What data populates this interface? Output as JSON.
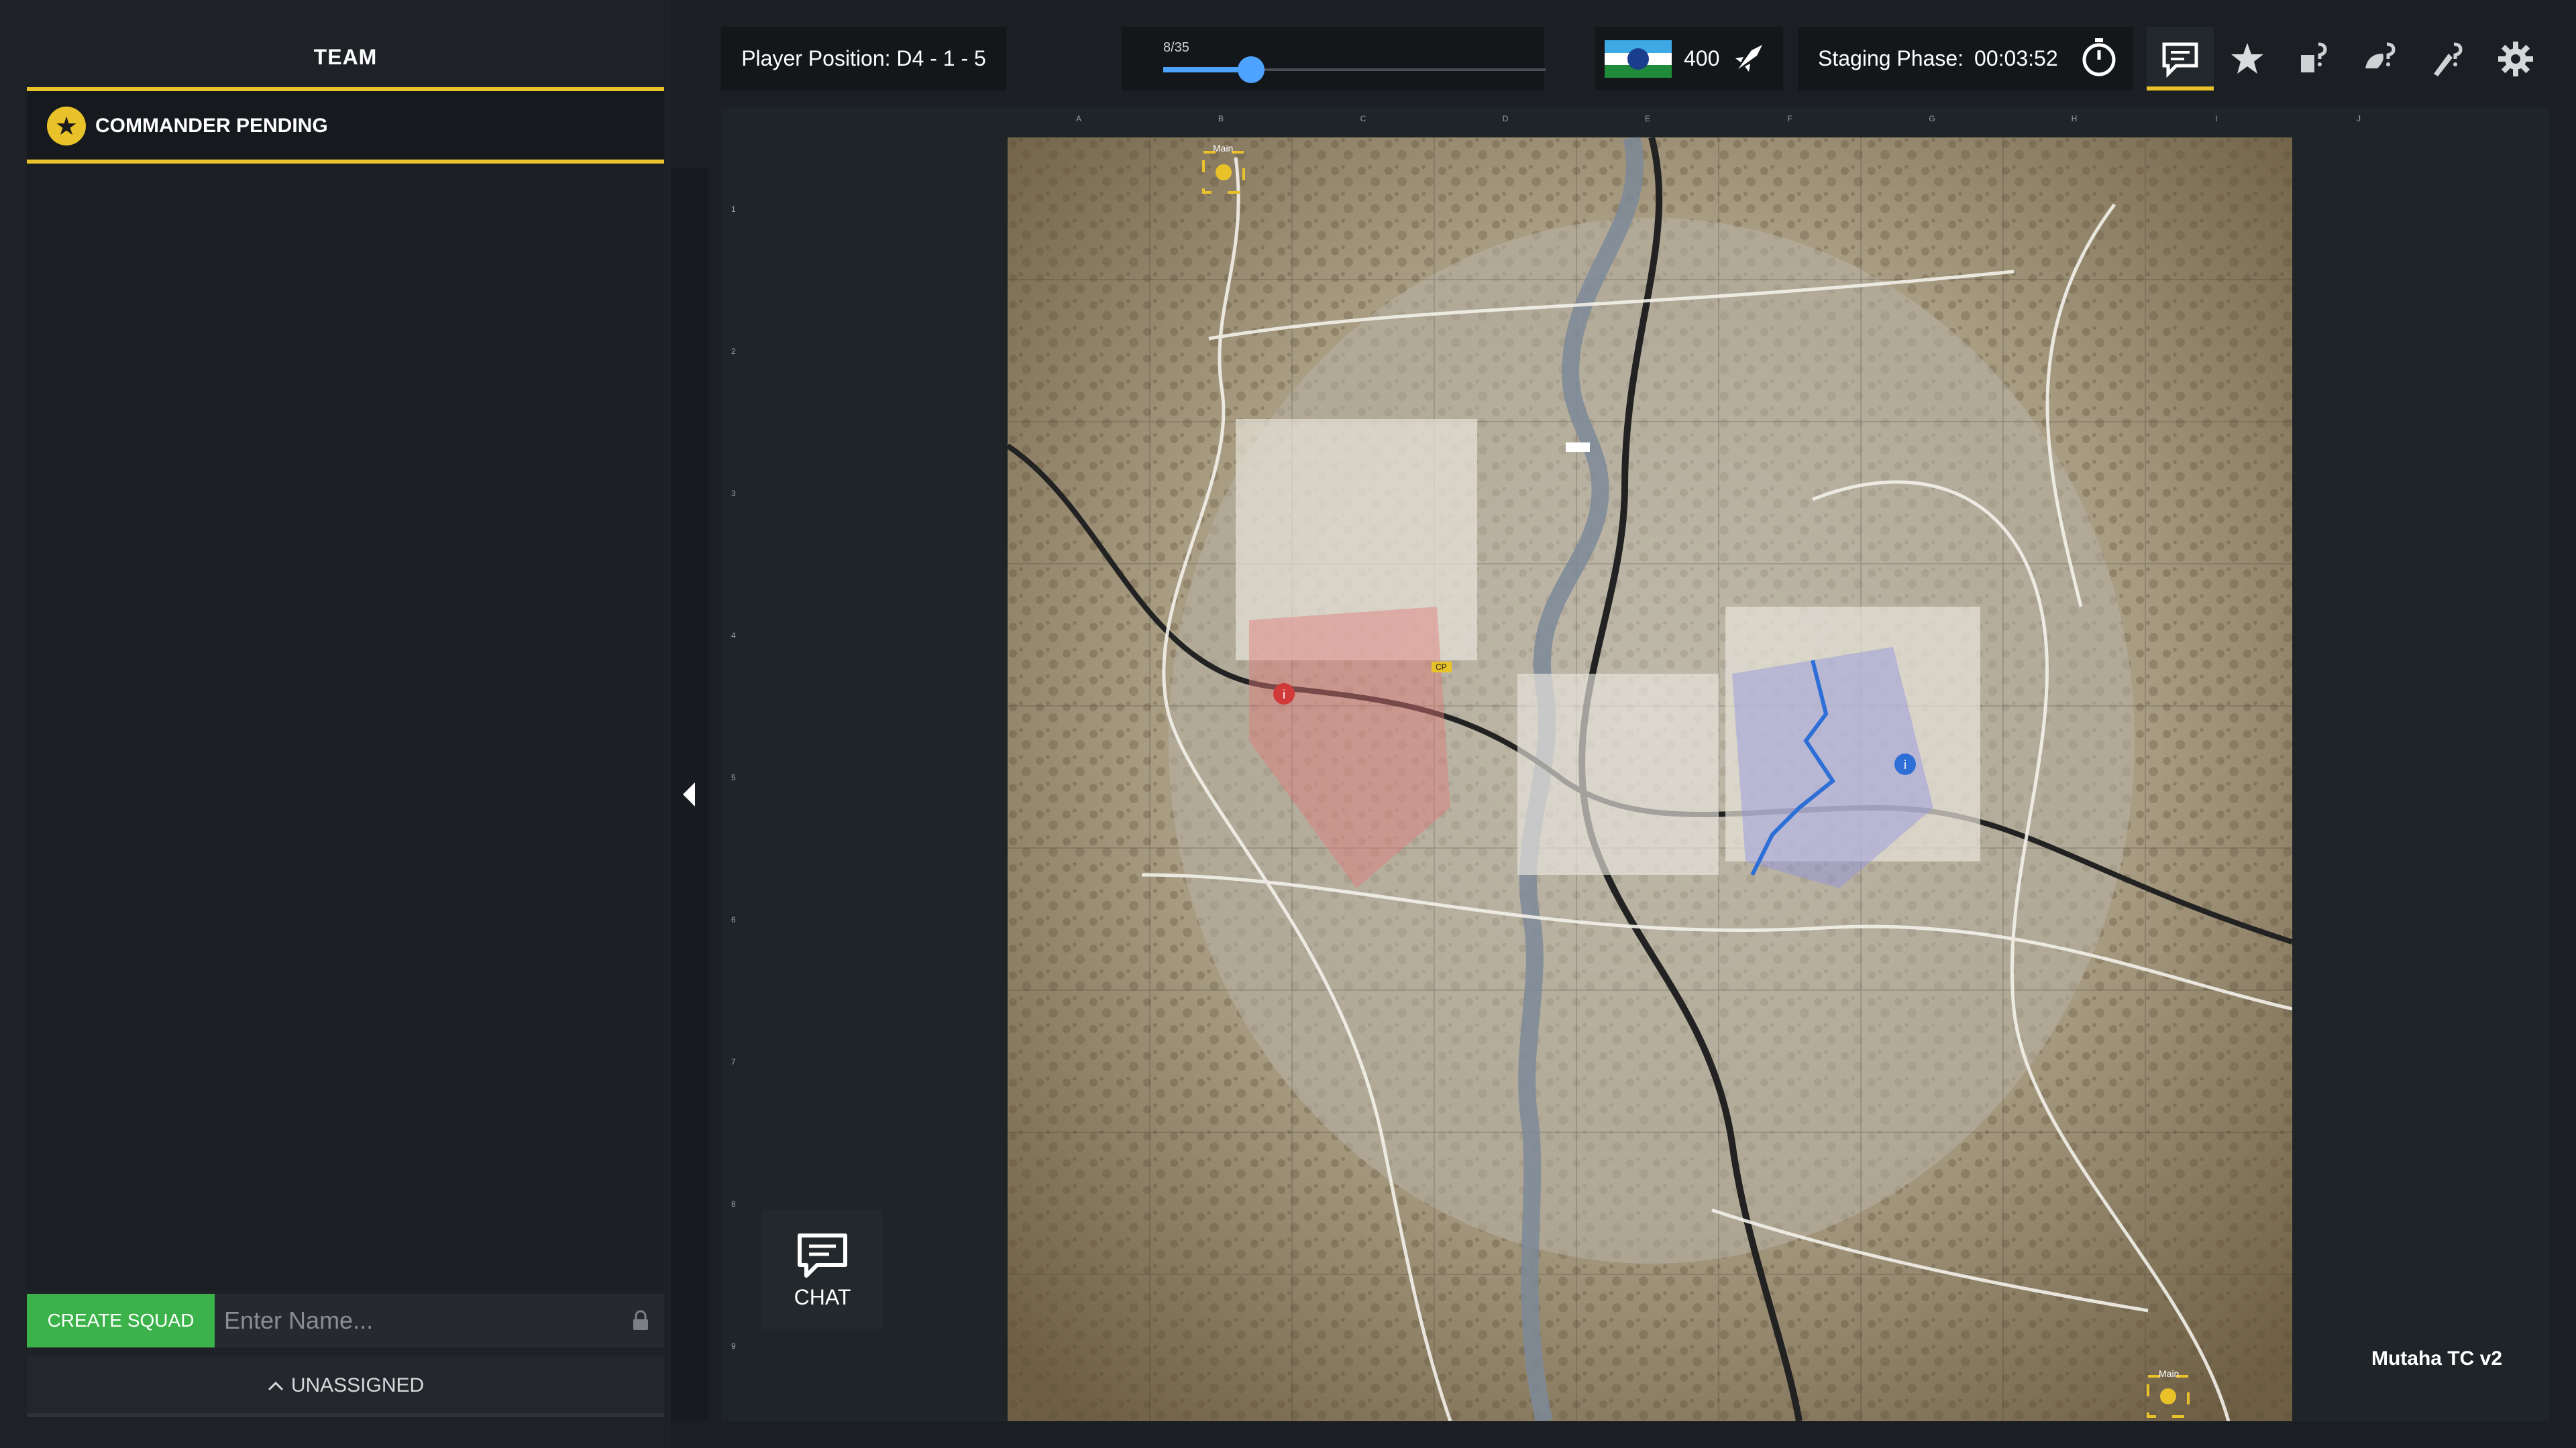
{
  "team": {
    "title": "TEAM",
    "commander_label": "COMMANDER PENDING",
    "create_squad_label": "CREATE SQUAD",
    "squad_name_placeholder": "Enter Name...",
    "unassigned_label": "UNASSIGNED"
  },
  "topbar": {
    "player_position": "Player Position: D4 - 1 - 5",
    "slider_label": "8/35",
    "slider_fraction": 0.23,
    "tickets": "400",
    "staging_label": "Staging Phase:",
    "staging_time": "00:03:52"
  },
  "toolbar_icons": [
    "chat-icon",
    "star-icon",
    "question-hand-icon",
    "question-helmet-icon",
    "question-ammo-icon",
    "gear-icon"
  ],
  "map": {
    "name": "Mutaha TC v2",
    "chat_label": "CHAT",
    "main_label": "Main",
    "objective_label": "CP",
    "col_labels": [
      "A",
      "B",
      "C",
      "D",
      "E",
      "F",
      "G",
      "H",
      "I",
      "J"
    ],
    "row_labels": [
      "1",
      "2",
      "3",
      "4",
      "5",
      "6",
      "7",
      "8",
      "9"
    ]
  },
  "colors": {
    "accent": "#e9c22a",
    "create_squad": "#3bb34a",
    "slider": "#4da3ff",
    "red_team": "#d23a3a",
    "blue_team": "#2d6fd6"
  }
}
